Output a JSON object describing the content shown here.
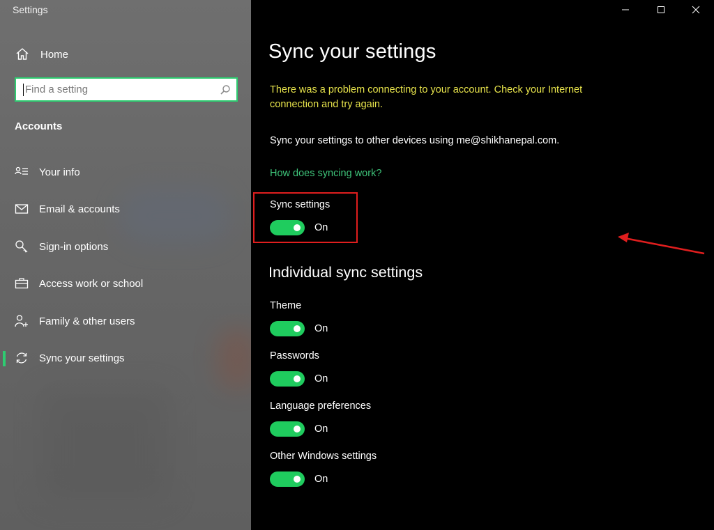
{
  "window": {
    "app_title": "Settings"
  },
  "sidebar": {
    "home_label": "Home",
    "search_placeholder": "Find a setting",
    "section_heading": "Accounts",
    "items": [
      {
        "label": "Your info",
        "icon": "person-card-icon"
      },
      {
        "label": "Email & accounts",
        "icon": "mail-icon"
      },
      {
        "label": "Sign-in options",
        "icon": "key-icon"
      },
      {
        "label": "Access work or school",
        "icon": "briefcase-icon"
      },
      {
        "label": "Family & other users",
        "icon": "person-add-icon"
      },
      {
        "label": "Sync your settings",
        "icon": "sync-icon",
        "selected": true
      }
    ]
  },
  "main": {
    "title": "Sync your settings",
    "warning": "There was a problem connecting to your account. Check your Internet connection and try again.",
    "description": "Sync your settings to other devices using me@shikhanepal.com.",
    "help_link": "How does syncing work?",
    "sync_setting": {
      "label": "Sync settings",
      "state": "On"
    },
    "section2_title": "Individual sync settings",
    "individual": [
      {
        "label": "Theme",
        "state": "On"
      },
      {
        "label": "Passwords",
        "state": "On"
      },
      {
        "label": "Language preferences",
        "state": "On"
      },
      {
        "label": "Other Windows settings",
        "state": "On"
      }
    ]
  },
  "colors": {
    "accent": "#1fcc5e",
    "link": "#3ec47a",
    "warning": "#e7e34b",
    "highlight": "#e01e1e",
    "sidebar_bg": "#6a6a6a",
    "main_bg": "#000000"
  }
}
